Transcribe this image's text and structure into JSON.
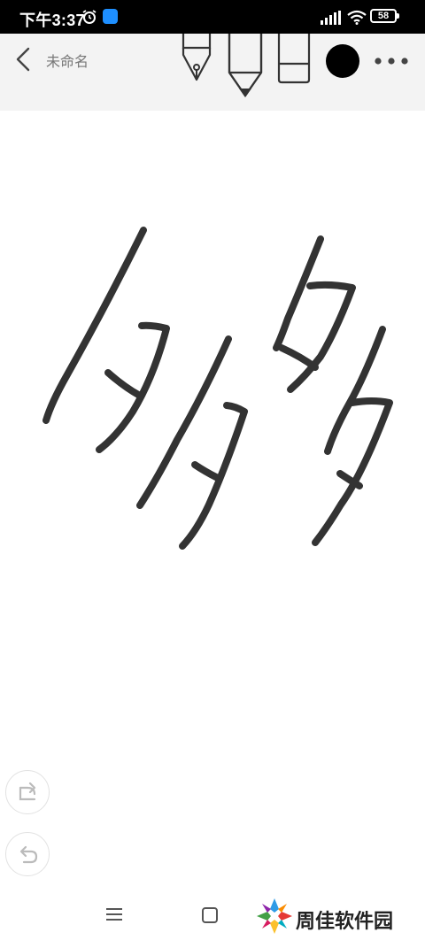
{
  "status_bar": {
    "time": "下午3:37",
    "battery": "58",
    "icons": [
      "alarm-icon",
      "app-notification-icon",
      "hd-signal-icon",
      "wifi-icon",
      "battery-icon"
    ]
  },
  "toolbar": {
    "back_icon": "chevron-left-icon",
    "title": "未命名",
    "tools": [
      "fountain-pen-icon",
      "marker-pen-icon",
      "eraser-icon"
    ],
    "current_color": "#000000",
    "more_icon": "more-dots-icon"
  },
  "canvas": {
    "content": "handwritten-strokes",
    "stroke_color": "#333333"
  },
  "side_buttons": {
    "redo_icon": "redo-icon",
    "undo_icon": "undo-icon"
  },
  "nav_bar": {
    "menu_icon": "menu-icon",
    "home_icon": "home-icon"
  },
  "watermark": {
    "text": "周佳软件园"
  }
}
